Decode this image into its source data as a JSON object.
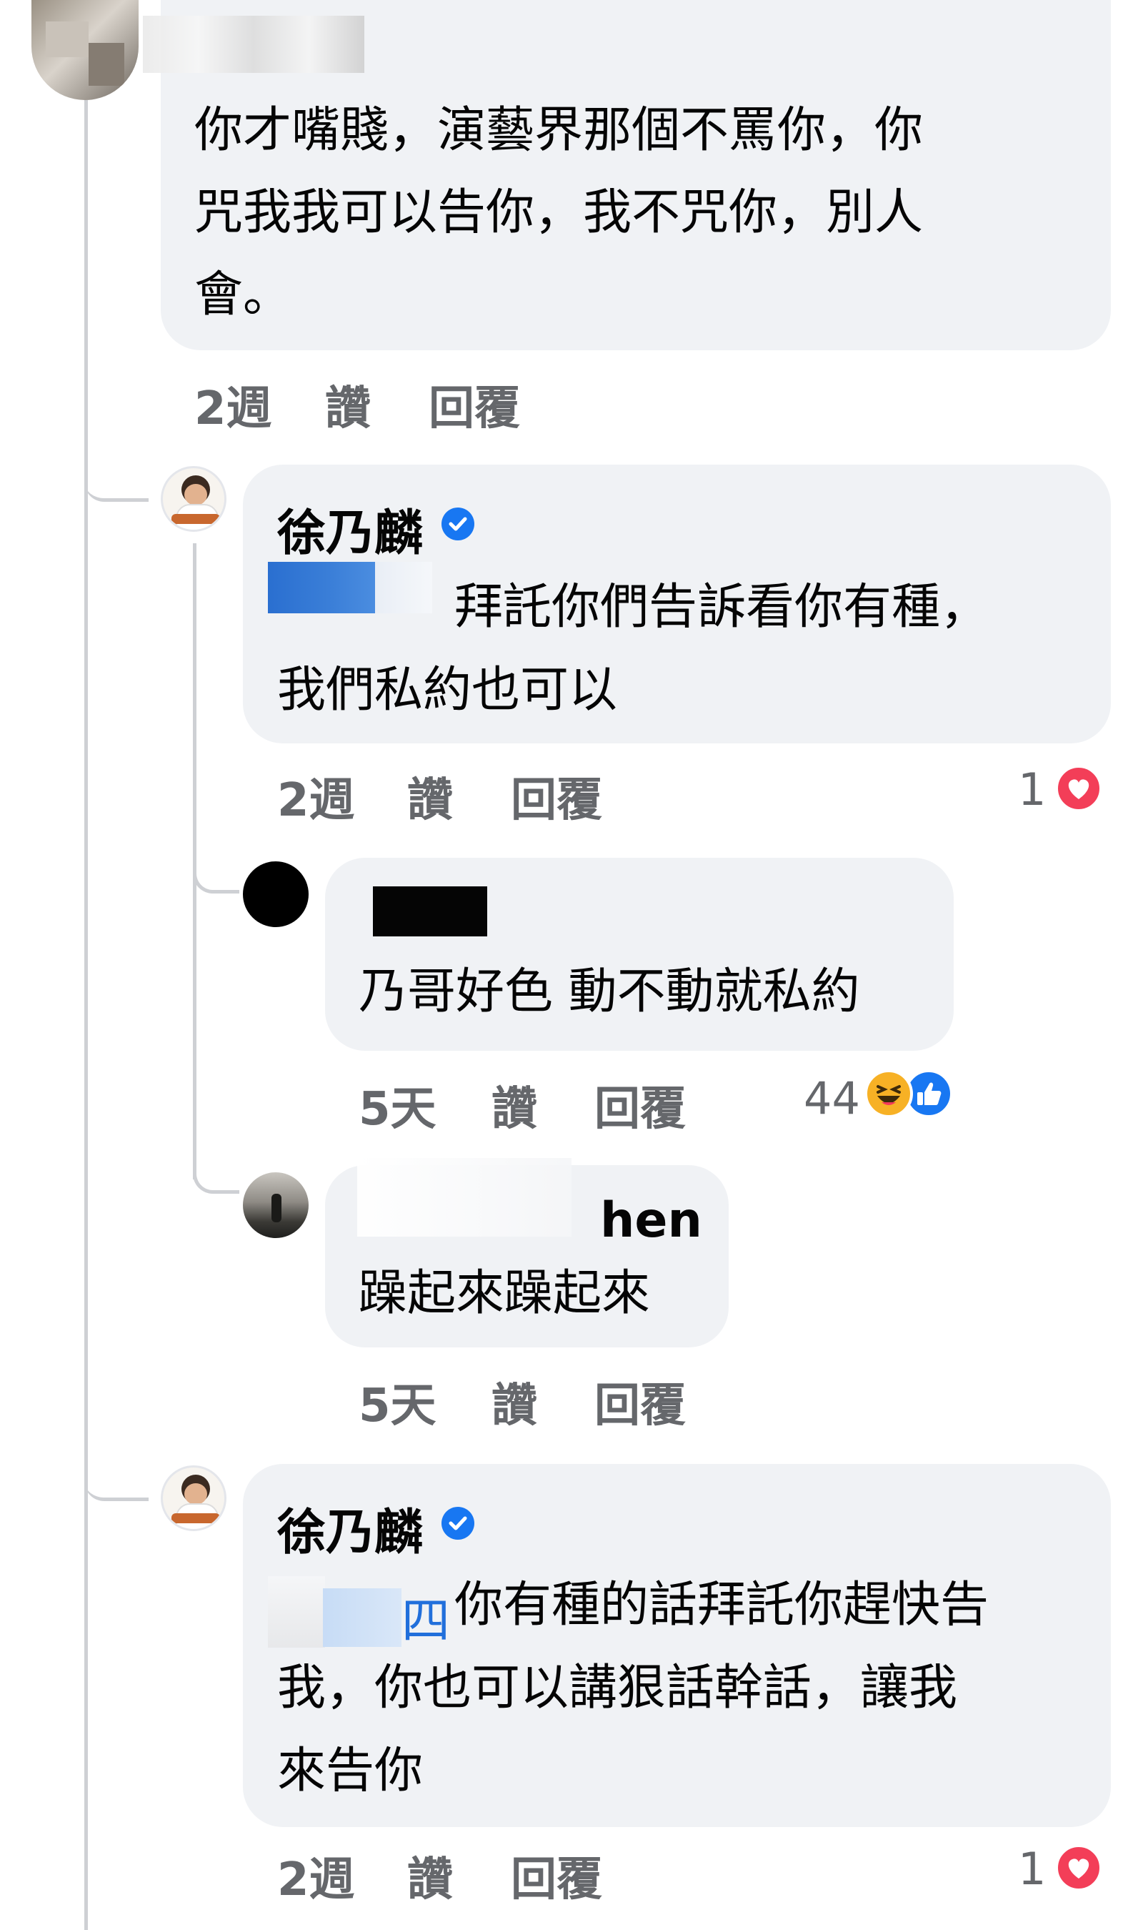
{
  "thread": {
    "comment": {
      "author_redacted": "",
      "lines": [
        "你才嘴賤，演藝界那個不罵你，你",
        "咒我我可以告你，我不咒你，別人",
        "會。"
      ],
      "time": "2週",
      "like_label": "讚",
      "reply_label": "回覆"
    },
    "reply1": {
      "author": "徐乃麟",
      "lines": [
        "拜託你們告訴看你有種，",
        "我們私約也可以"
      ],
      "time": "2週",
      "like_label": "讚",
      "reply_label": "回覆",
      "reaction_count": "1"
    },
    "reply2": {
      "author_suffix": "",
      "lines": [
        "乃哥好色 動不動就私約"
      ],
      "time": "5天",
      "like_label": "讚",
      "reply_label": "回覆",
      "reaction_count": "44"
    },
    "reply3": {
      "author_suffix": "hen",
      "lines": [
        "躁起來躁起來"
      ],
      "time": "5天",
      "like_label": "讚",
      "reply_label": "回覆"
    },
    "reply4": {
      "author": "徐乃麟",
      "mention_tail": "四",
      "lines": [
        "你有種的話拜託你趕快告",
        "我，你也可以講狠話幹話，讓我",
        "來告你"
      ],
      "time": "2週",
      "like_label": "讚",
      "reply_label": "回覆",
      "reaction_count": "1"
    }
  },
  "icons": [
    "verified-badge-icon",
    "love-reaction-icon",
    "haha-reaction-icon",
    "like-reaction-icon"
  ],
  "colors": {
    "bubble": "#f0f2f5",
    "meta_text": "#65676b",
    "verified": "#1877f2",
    "love": "#f33e58",
    "haha": "#f7b125",
    "like": "#1877f2",
    "thread_line": "#ced0d4"
  }
}
